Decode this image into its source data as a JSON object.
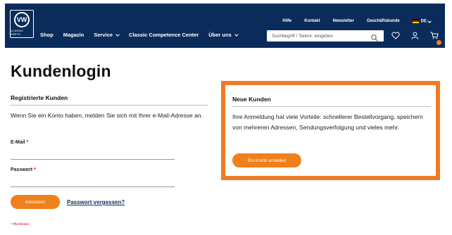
{
  "header": {
    "logo": {
      "icon": "vw-logo-icon",
      "text": "VW",
      "sub": "CLASSIC PARTS"
    },
    "main_nav": [
      "Shop",
      "Magazin",
      "Service",
      "Classic Competence Center",
      "Über uns"
    ],
    "top_nav": [
      "Hilfe",
      "Kontakt",
      "Newsletter",
      "Geschäftskunde"
    ],
    "language": "DE",
    "search_placeholder": "Suchbegriff / Teilenr. eingeben",
    "icons": [
      "search-icon",
      "heart-icon",
      "user-icon",
      "cart-icon"
    ]
  },
  "page": {
    "title": "Kundenlogin"
  },
  "registered": {
    "heading": "Registrierte Kunden",
    "description": "Wenn Sie ein Konto haben, melden Sie sich mit Ihrer e-Mail-Adresse an.",
    "email_label": "E-Mail",
    "password_label": "Passwort",
    "required_marker": "*",
    "login_button": "Anmelden",
    "forgot_link": "Passwort vergessen?",
    "required_note": "* Pflichtfelder"
  },
  "new_customers": {
    "heading": "Neue Kunden",
    "description": "Ihre Anmeldung hat viele Vorteile: schnellerer Bestellvorgang, speichern von mehreren Adressen, Sendungsverfolgung und vieles mehr.",
    "create_button": "Ein Konto erstellen"
  },
  "colors": {
    "header_bg": "#0b2c5a",
    "accent": "#f0801c",
    "highlight_border": "#f07a23"
  }
}
